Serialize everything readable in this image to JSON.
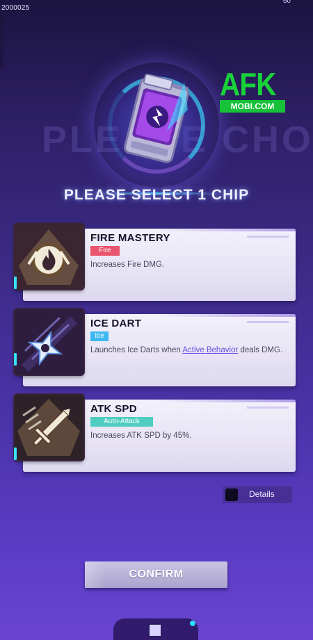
{
  "status": {
    "id_text": "2000025",
    "corner_text": "60"
  },
  "hero": {
    "background_word": "PLEASE CHOOSE YOUR CHIP",
    "title": "PLEASE SELECT 1 CHIP"
  },
  "watermark": {
    "word": "AFK",
    "sub": "MOBI.COM"
  },
  "chips": [
    {
      "name": "FIRE MASTERY",
      "tag": "Fire",
      "desc": "Increases Fire DMG.",
      "icon": "flame-emblem-icon",
      "tag_color": "#e8556c"
    },
    {
      "name": "ICE DART",
      "tag": "Ice",
      "desc_before": "Launches Ice Darts when ",
      "desc_link": "Active Behavior",
      "desc_after": " deals DMG.",
      "icon": "shuriken-icon",
      "tag_color": "#3db8f0"
    },
    {
      "name": "ATK SPD",
      "tag": "Auto-Attack",
      "desc": "Increases ATK SPD by 45%.",
      "icon": "sword-icon",
      "tag_color": "#4ecdc0"
    }
  ],
  "details": {
    "label": "Details"
  },
  "confirm": {
    "label": "CONFIRM"
  },
  "bottom_nav": {
    "icon": "chip-icon"
  }
}
